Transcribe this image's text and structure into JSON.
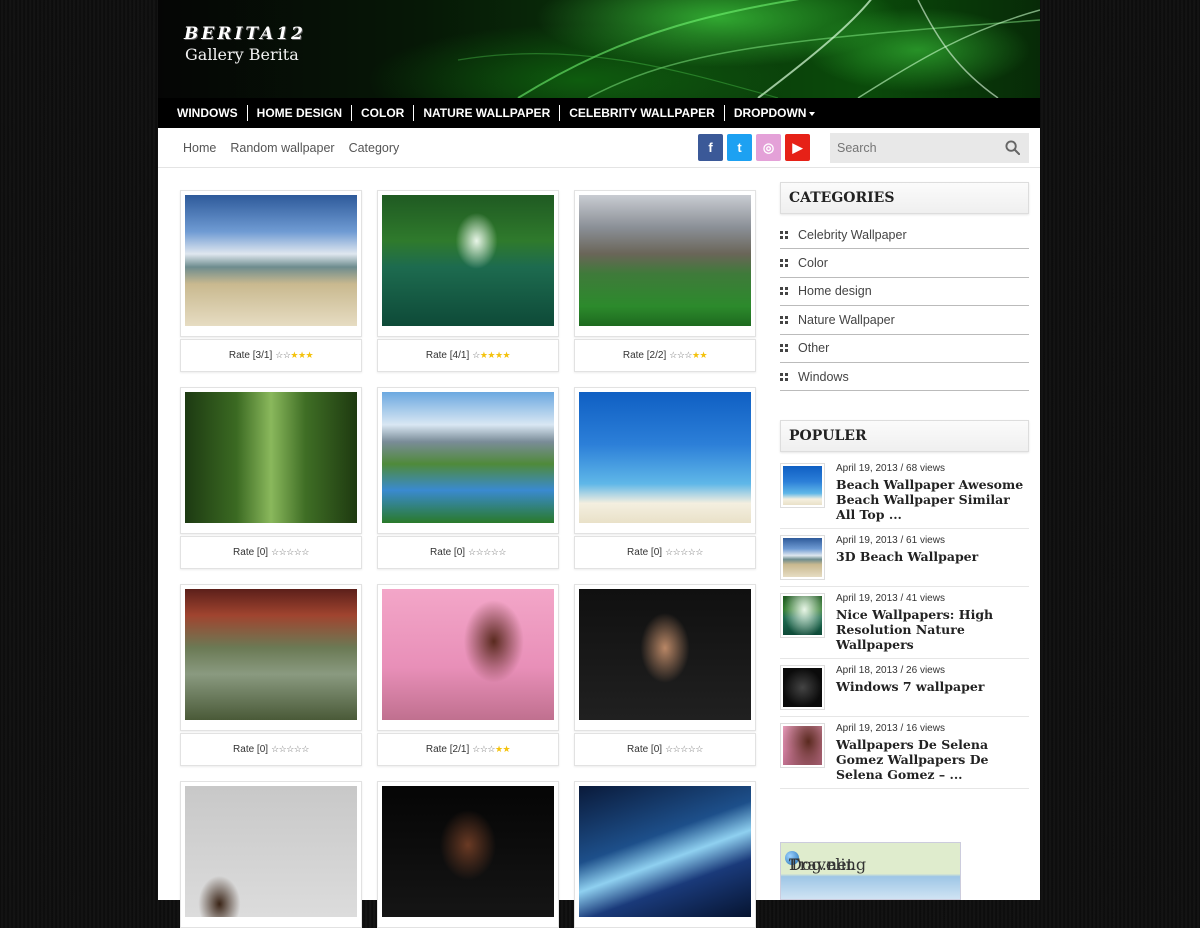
{
  "brand": {
    "logo_top": "BERITA12",
    "logo_sub": "Gallery Berita"
  },
  "topnav": [
    "WINDOWS",
    "HOME DESIGN",
    "COLOR",
    "NATURE WALLPAPER",
    "CELEBRITY WALLPAPER",
    "DROPDOWN"
  ],
  "subnav": {
    "links": [
      "Home",
      "Random wallpaper",
      "Category"
    ]
  },
  "social": [
    {
      "icon": "facebook-icon",
      "glyph": "f",
      "color": "#3b5998"
    },
    {
      "icon": "twitter-icon",
      "glyph": "t",
      "color": "#1da1f2"
    },
    {
      "icon": "instagram-icon",
      "glyph": "◎",
      "color": "#e4a1d8"
    },
    {
      "icon": "youtube-icon",
      "glyph": "▶",
      "color": "#e62117"
    }
  ],
  "search": {
    "placeholder": "Search"
  },
  "grid": [
    {
      "rate": "Rate [3/1]",
      "stars": 3,
      "theme": "beach-island"
    },
    {
      "rate": "Rate [4/1]",
      "stars": 4,
      "theme": "green-waterfall"
    },
    {
      "rate": "Rate [2/2]",
      "stars": 2,
      "theme": "village-garden"
    },
    {
      "rate": "Rate [0]",
      "stars": 0,
      "theme": "forest-path"
    },
    {
      "rate": "Rate [0]",
      "stars": 0,
      "theme": "mountain-valley"
    },
    {
      "rate": "Rate [0]",
      "stars": 0,
      "theme": "beach-hammock"
    },
    {
      "rate": "Rate [0]",
      "stars": 0,
      "theme": "autumn-fence"
    },
    {
      "rate": "Rate [2/1]",
      "stars": 2,
      "theme": "celebrity-pink"
    },
    {
      "rate": "Rate [0]",
      "stars": 0,
      "theme": "celebrity-dark"
    },
    {
      "rate": "",
      "stars": -1,
      "theme": "celebrity-grey"
    },
    {
      "rate": "",
      "stars": -1,
      "theme": "celebrity-black"
    },
    {
      "rate": "",
      "stars": -1,
      "theme": "abstract-blue"
    }
  ],
  "sidebar": {
    "categories_title": "CATEGORIES",
    "categories": [
      "Celebrity Wallpaper",
      "Color",
      "Home design",
      "Nature Wallpaper",
      "Other",
      "Windows"
    ],
    "popular_title": "POPULER",
    "popular": [
      {
        "meta": "April 19, 2013 / 68 views",
        "title": "Beach Wallpaper Awesome Beach Wallpaper Similar All Top ...",
        "theme": "beach-hammock"
      },
      {
        "meta": "April 19, 2013 / 61 views",
        "title": "3D Beach Wallpaper",
        "theme": "beach-island"
      },
      {
        "meta": "April 19, 2013 / 41 views",
        "title": "Nice Wallpapers: High Resolution Nature Wallpapers",
        "theme": "green-waterfall"
      },
      {
        "meta": "April 18, 2013 / 26 views",
        "title": "Windows 7 wallpaper",
        "theme": "windows-dark"
      },
      {
        "meta": "April 19, 2013 / 16 views",
        "title": "Wallpapers De Selena Gomez Wallpapers De Selena Gomez – ...",
        "theme": "celebrity-pink"
      }
    ],
    "ad_text": "Traveling",
    "ad_text2": "Dog.net"
  }
}
